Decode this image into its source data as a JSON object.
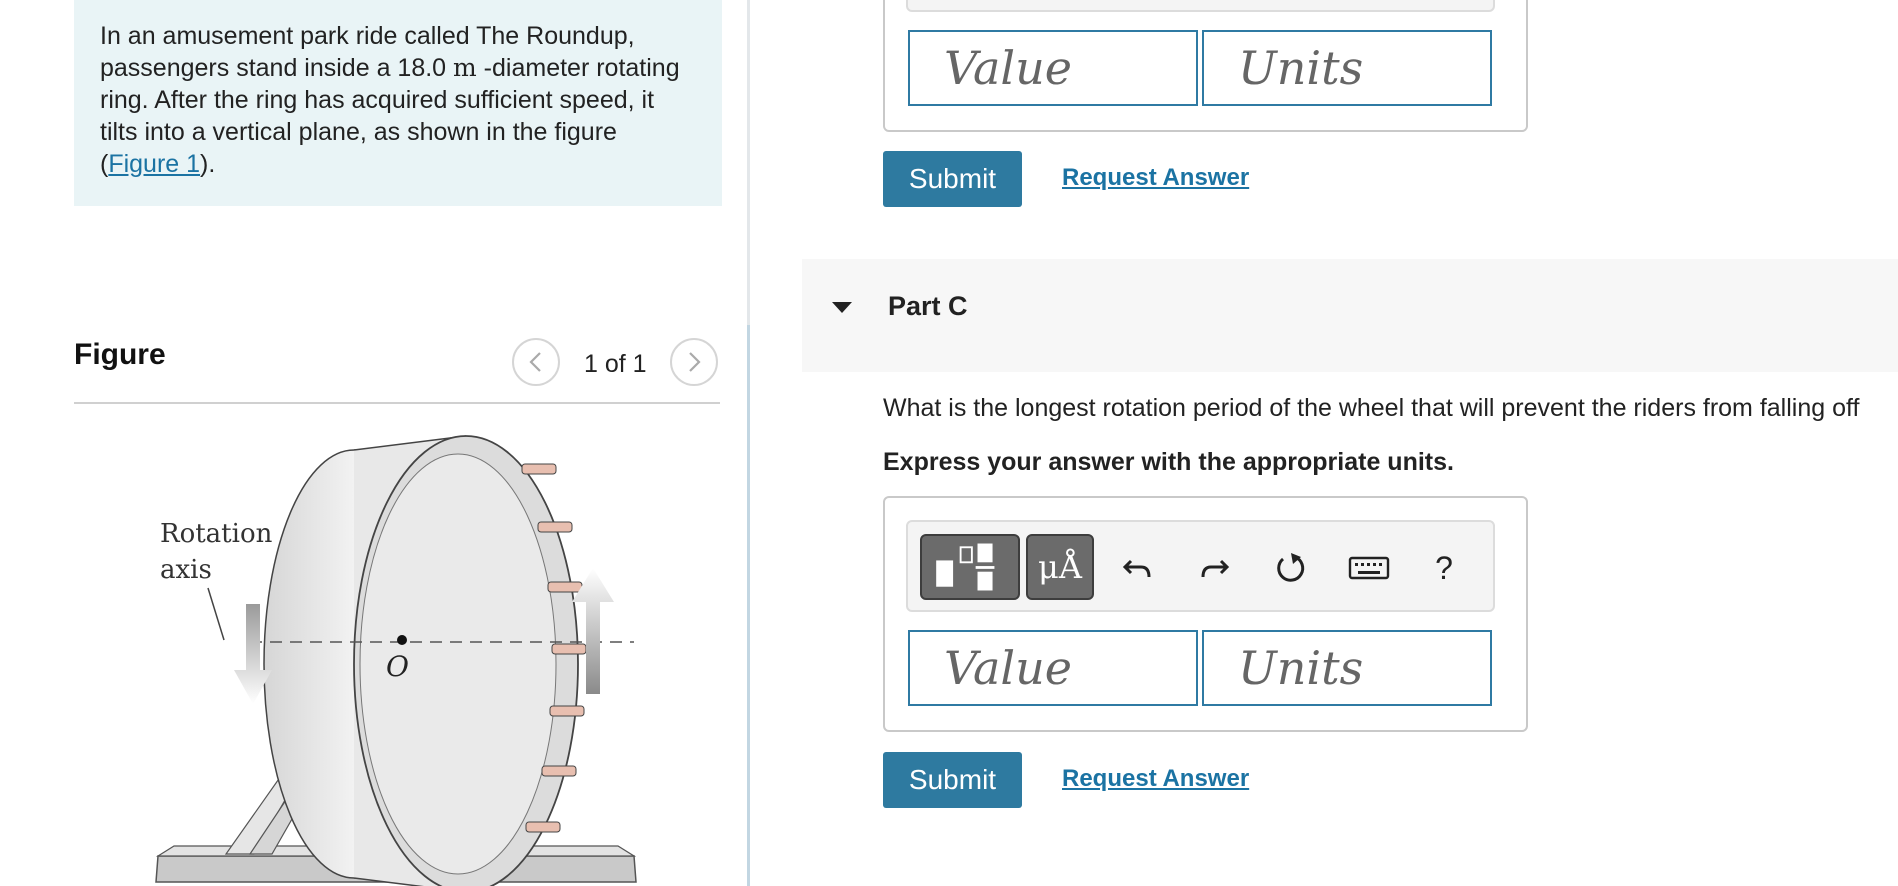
{
  "problem": {
    "text_before": "In an amusement park ride called The Roundup, passengers stand inside a 18.0 ",
    "unit": "m",
    "text_after": " -diameter rotating ring. After the ring has acquired sufficient speed, it tilts into a vertical plane, as shown in the figure (",
    "figure_link": "Figure 1",
    "text_end": ")."
  },
  "figure": {
    "heading": "Figure",
    "counter": "1 of 1",
    "label_rotation": "Rotation",
    "label_axis": "axis",
    "label_center": "O"
  },
  "part_b": {
    "value_placeholder": "Value",
    "units_placeholder": "Units",
    "submit_label": "Submit",
    "request_label": "Request Answer"
  },
  "part_c": {
    "title": "Part C",
    "question": "What is the longest rotation period of the wheel that will prevent the riders from falling off",
    "instruction": "Express your answer with the appropriate units.",
    "toolbar": {
      "units_symbol": "μÅ",
      "help_symbol": "?",
      "icons": [
        "template-icon",
        "units-icon",
        "undo-icon",
        "redo-icon",
        "reset-icon",
        "keyboard-icon",
        "help-icon"
      ]
    },
    "value_placeholder": "Value",
    "units_placeholder": "Units",
    "submit_label": "Submit",
    "request_label": "Request Answer"
  },
  "colors": {
    "accent": "#2e7aa0",
    "link": "#1b73a3",
    "intro_bg": "#e9f4f6",
    "part_header_bg": "#f7f7f7"
  }
}
